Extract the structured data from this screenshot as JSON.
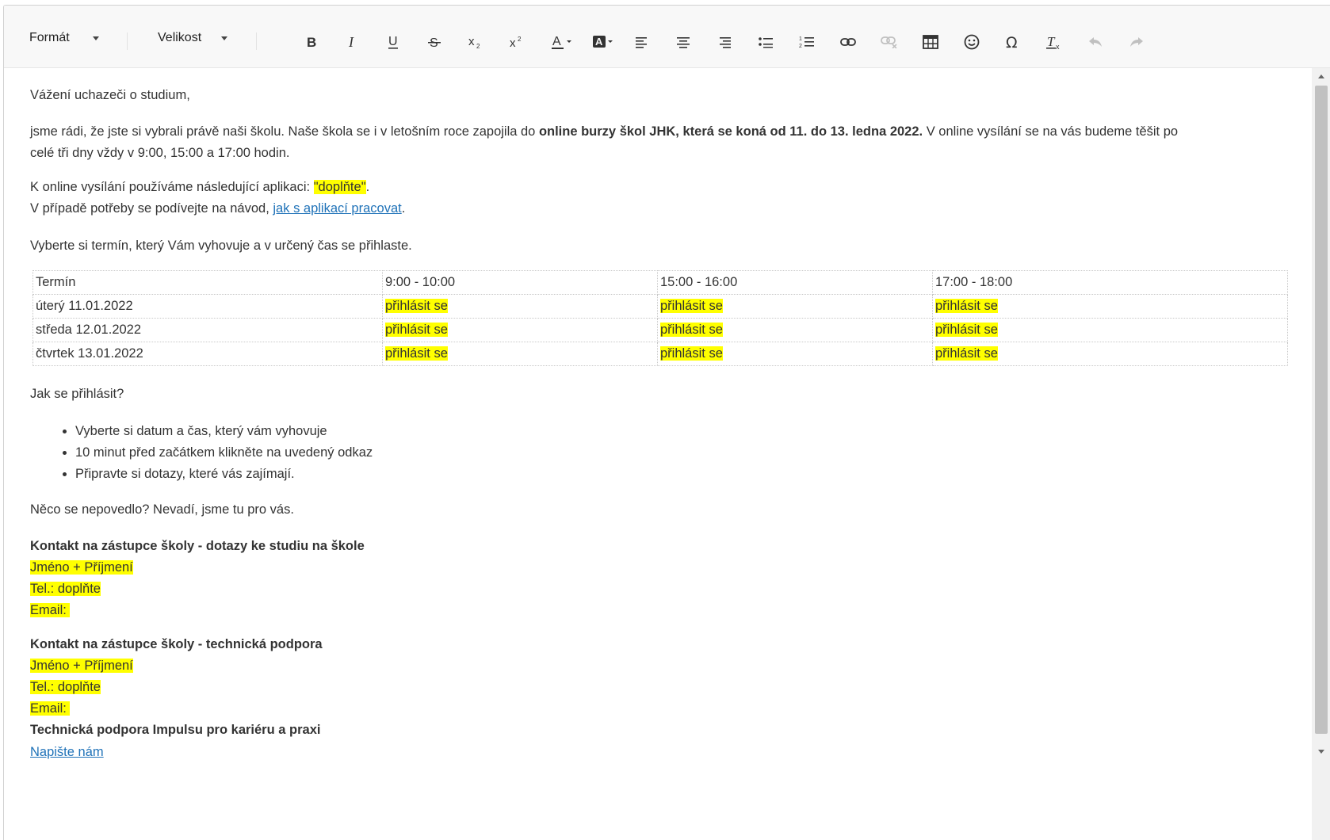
{
  "toolbar": {
    "format_label": "Formát",
    "size_label": "Velikost"
  },
  "content": {
    "greeting": "Vážení uchazeči o studium,",
    "intro_part1": "jsme rádi, že jste si vybrali právě naši školu. Naše škola se i v letošním roce zapojila do ",
    "intro_bold": "online burzy škol JHK, která se koná od 11. do 13. ledna 2022.",
    "intro_part2": " V online vysílání se na vás budeme těšit po",
    "intro_line2": "celé tři dny vždy v 9:00, 15:00 a 17:00 hodin.",
    "app_line_prefix": "K online vysílání používáme následující aplikaci: ",
    "app_placeholder": "\"doplňte\"",
    "app_line_suffix": ".",
    "guide_prefix": "V případě potřeby se podívejte na návod, ",
    "guide_link": "jak s aplikací pracovat",
    "guide_suffix": ".",
    "choose_line": "Vyberte si termín, který Vám vyhovuje a v určený čas se přihlaste.",
    "table": {
      "header": [
        "Termín",
        "9:00 - 10:00",
        "15:00 - 16:00",
        "17:00 - 18:00"
      ],
      "rows": [
        [
          "úterý 11.01.2022",
          "přihlásit se",
          "přihlásit se",
          "přihlásit se"
        ],
        [
          "středa 12.01.2022",
          "přihlásit se",
          "přihlásit se",
          "přihlásit se"
        ],
        [
          "čtvrtek 13.01.2022",
          "přihlásit se",
          "přihlásit se",
          "přihlásit se"
        ]
      ]
    },
    "how_heading": "Jak se přihlásit?",
    "steps": [
      "Vyberte si datum a čas, který vám vyhovuje",
      "10 minut před začátkem klikněte na uvedený odkaz",
      "Připravte si dotazy, které vás zajímají."
    ],
    "help_line": "Něco se nepovedlo? Nevadí, jsme tu pro vás.",
    "contact1": {
      "title": "Kontakt na zástupce školy - dotazy ke studiu na škole",
      "name": "Jméno + Příjmení",
      "tel": "Tel.: doplňte",
      "email": "Email: "
    },
    "contact2": {
      "title": "Kontakt na zástupce školy - technická podpora",
      "name": "Jméno + Příjmení",
      "tel": "Tel.: doplňte",
      "email": "Email: "
    },
    "support_title": "Technická podpora Impulsu pro kariéru a praxi",
    "support_link": "Napište nám"
  },
  "colors": {
    "highlight": "#ffff00",
    "link": "#1f72b8",
    "toolbar_bg": "#f8f8f8"
  }
}
